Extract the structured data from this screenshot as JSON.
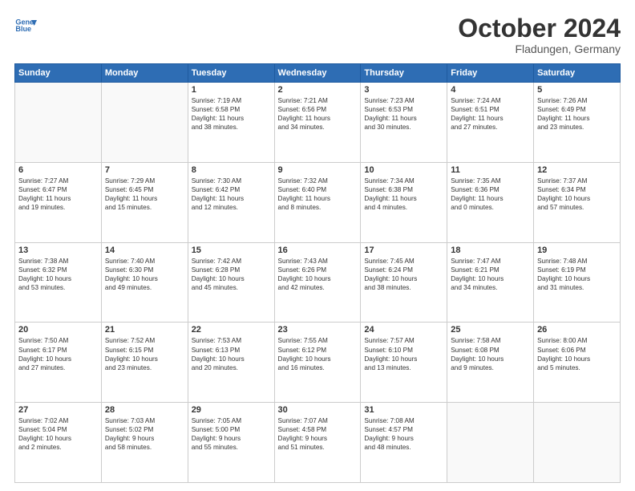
{
  "header": {
    "logo_line1": "General",
    "logo_line2": "Blue",
    "month": "October 2024",
    "location": "Fladungen, Germany"
  },
  "weekdays": [
    "Sunday",
    "Monday",
    "Tuesday",
    "Wednesday",
    "Thursday",
    "Friday",
    "Saturday"
  ],
  "weeks": [
    [
      {
        "day": "",
        "text": ""
      },
      {
        "day": "",
        "text": ""
      },
      {
        "day": "1",
        "text": "Sunrise: 7:19 AM\nSunset: 6:58 PM\nDaylight: 11 hours\nand 38 minutes."
      },
      {
        "day": "2",
        "text": "Sunrise: 7:21 AM\nSunset: 6:56 PM\nDaylight: 11 hours\nand 34 minutes."
      },
      {
        "day": "3",
        "text": "Sunrise: 7:23 AM\nSunset: 6:53 PM\nDaylight: 11 hours\nand 30 minutes."
      },
      {
        "day": "4",
        "text": "Sunrise: 7:24 AM\nSunset: 6:51 PM\nDaylight: 11 hours\nand 27 minutes."
      },
      {
        "day": "5",
        "text": "Sunrise: 7:26 AM\nSunset: 6:49 PM\nDaylight: 11 hours\nand 23 minutes."
      }
    ],
    [
      {
        "day": "6",
        "text": "Sunrise: 7:27 AM\nSunset: 6:47 PM\nDaylight: 11 hours\nand 19 minutes."
      },
      {
        "day": "7",
        "text": "Sunrise: 7:29 AM\nSunset: 6:45 PM\nDaylight: 11 hours\nand 15 minutes."
      },
      {
        "day": "8",
        "text": "Sunrise: 7:30 AM\nSunset: 6:42 PM\nDaylight: 11 hours\nand 12 minutes."
      },
      {
        "day": "9",
        "text": "Sunrise: 7:32 AM\nSunset: 6:40 PM\nDaylight: 11 hours\nand 8 minutes."
      },
      {
        "day": "10",
        "text": "Sunrise: 7:34 AM\nSunset: 6:38 PM\nDaylight: 11 hours\nand 4 minutes."
      },
      {
        "day": "11",
        "text": "Sunrise: 7:35 AM\nSunset: 6:36 PM\nDaylight: 11 hours\nand 0 minutes."
      },
      {
        "day": "12",
        "text": "Sunrise: 7:37 AM\nSunset: 6:34 PM\nDaylight: 10 hours\nand 57 minutes."
      }
    ],
    [
      {
        "day": "13",
        "text": "Sunrise: 7:38 AM\nSunset: 6:32 PM\nDaylight: 10 hours\nand 53 minutes."
      },
      {
        "day": "14",
        "text": "Sunrise: 7:40 AM\nSunset: 6:30 PM\nDaylight: 10 hours\nand 49 minutes."
      },
      {
        "day": "15",
        "text": "Sunrise: 7:42 AM\nSunset: 6:28 PM\nDaylight: 10 hours\nand 45 minutes."
      },
      {
        "day": "16",
        "text": "Sunrise: 7:43 AM\nSunset: 6:26 PM\nDaylight: 10 hours\nand 42 minutes."
      },
      {
        "day": "17",
        "text": "Sunrise: 7:45 AM\nSunset: 6:24 PM\nDaylight: 10 hours\nand 38 minutes."
      },
      {
        "day": "18",
        "text": "Sunrise: 7:47 AM\nSunset: 6:21 PM\nDaylight: 10 hours\nand 34 minutes."
      },
      {
        "day": "19",
        "text": "Sunrise: 7:48 AM\nSunset: 6:19 PM\nDaylight: 10 hours\nand 31 minutes."
      }
    ],
    [
      {
        "day": "20",
        "text": "Sunrise: 7:50 AM\nSunset: 6:17 PM\nDaylight: 10 hours\nand 27 minutes."
      },
      {
        "day": "21",
        "text": "Sunrise: 7:52 AM\nSunset: 6:15 PM\nDaylight: 10 hours\nand 23 minutes."
      },
      {
        "day": "22",
        "text": "Sunrise: 7:53 AM\nSunset: 6:13 PM\nDaylight: 10 hours\nand 20 minutes."
      },
      {
        "day": "23",
        "text": "Sunrise: 7:55 AM\nSunset: 6:12 PM\nDaylight: 10 hours\nand 16 minutes."
      },
      {
        "day": "24",
        "text": "Sunrise: 7:57 AM\nSunset: 6:10 PM\nDaylight: 10 hours\nand 13 minutes."
      },
      {
        "day": "25",
        "text": "Sunrise: 7:58 AM\nSunset: 6:08 PM\nDaylight: 10 hours\nand 9 minutes."
      },
      {
        "day": "26",
        "text": "Sunrise: 8:00 AM\nSunset: 6:06 PM\nDaylight: 10 hours\nand 5 minutes."
      }
    ],
    [
      {
        "day": "27",
        "text": "Sunrise: 7:02 AM\nSunset: 5:04 PM\nDaylight: 10 hours\nand 2 minutes."
      },
      {
        "day": "28",
        "text": "Sunrise: 7:03 AM\nSunset: 5:02 PM\nDaylight: 9 hours\nand 58 minutes."
      },
      {
        "day": "29",
        "text": "Sunrise: 7:05 AM\nSunset: 5:00 PM\nDaylight: 9 hours\nand 55 minutes."
      },
      {
        "day": "30",
        "text": "Sunrise: 7:07 AM\nSunset: 4:58 PM\nDaylight: 9 hours\nand 51 minutes."
      },
      {
        "day": "31",
        "text": "Sunrise: 7:08 AM\nSunset: 4:57 PM\nDaylight: 9 hours\nand 48 minutes."
      },
      {
        "day": "",
        "text": ""
      },
      {
        "day": "",
        "text": ""
      }
    ]
  ]
}
